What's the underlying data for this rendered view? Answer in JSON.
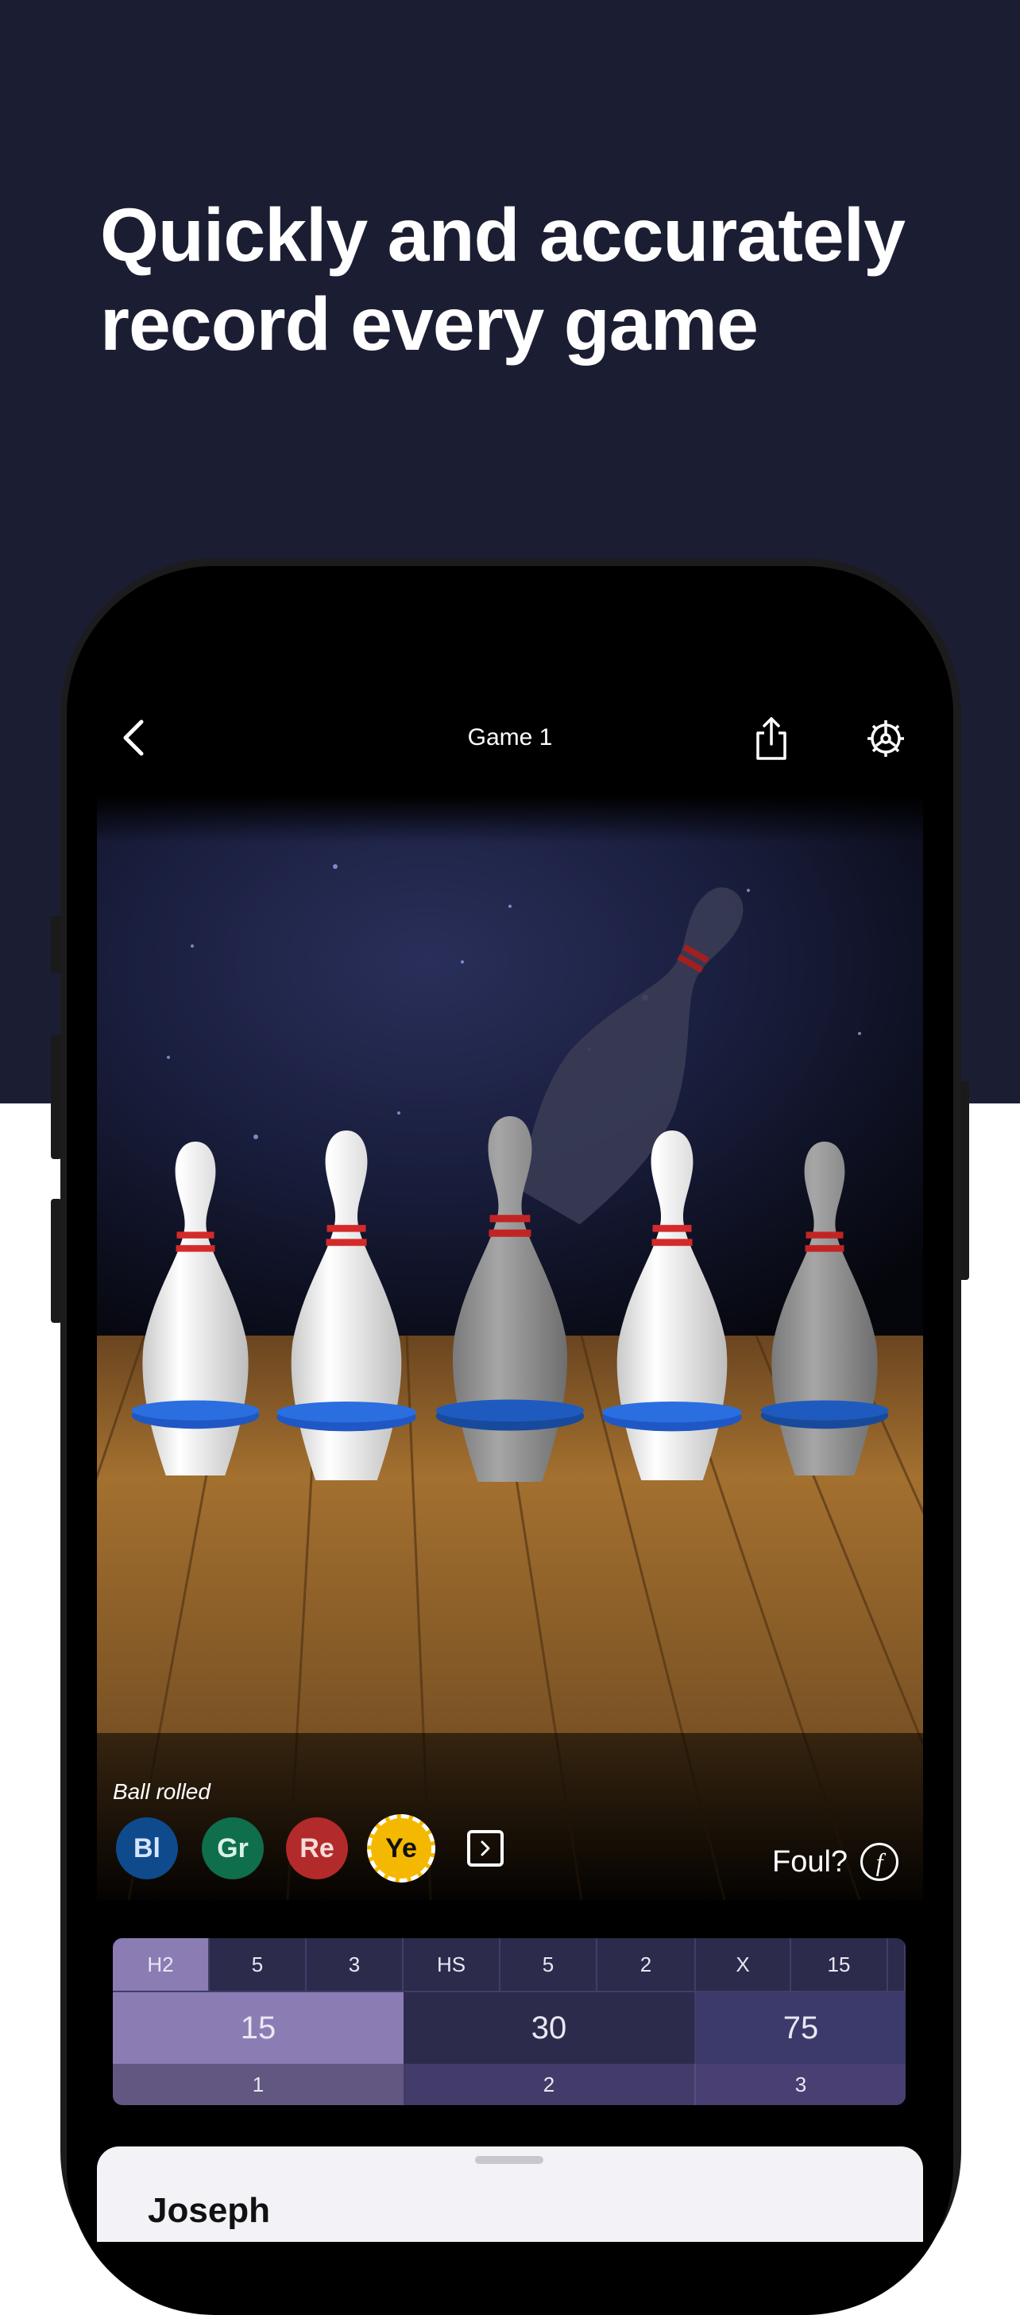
{
  "headline": {
    "line1": "Quickly and accurately",
    "line2": "record every game"
  },
  "nav": {
    "title": "Game 1",
    "back_icon": "chevron-left-icon",
    "share_icon": "share-icon",
    "settings_icon": "gear-icon"
  },
  "pins": [
    {
      "state": "standing"
    },
    {
      "state": "standing"
    },
    {
      "state": "knocked"
    },
    {
      "state": "standing"
    },
    {
      "state": "knocked"
    }
  ],
  "ball_rolled": {
    "label": "Ball rolled",
    "balls": [
      {
        "label": "Bl",
        "color": "#0f4a8c",
        "text_color": "#d6e4ff",
        "selected": false
      },
      {
        "label": "Gr",
        "color": "#0f6e4c",
        "text_color": "#d8f2e4",
        "selected": false
      },
      {
        "label": "Re",
        "color": "#b32a2a",
        "text_color": "#f7dada",
        "selected": false
      },
      {
        "label": "Ye",
        "color": "#f5b800",
        "text_color": "#111111",
        "selected": true
      }
    ]
  },
  "foul": {
    "label": "Foul?",
    "icon_glyph": "f"
  },
  "scoreboard": {
    "frames": [
      {
        "rolls": [
          "H2",
          "5",
          "3"
        ],
        "total": "15",
        "number": "1",
        "active": true
      },
      {
        "rolls": [
          "HS",
          "5",
          "2"
        ],
        "total": "30",
        "number": "2",
        "active": false
      },
      {
        "rolls": [
          "X",
          "15",
          ""
        ],
        "total": "75",
        "number": "3",
        "active": false
      }
    ]
  },
  "sheet": {
    "player_name": "Joseph"
  },
  "colors": {
    "background_top": "#1b1e33",
    "active_frame": "#8c7cb4",
    "board": "#29284a"
  }
}
